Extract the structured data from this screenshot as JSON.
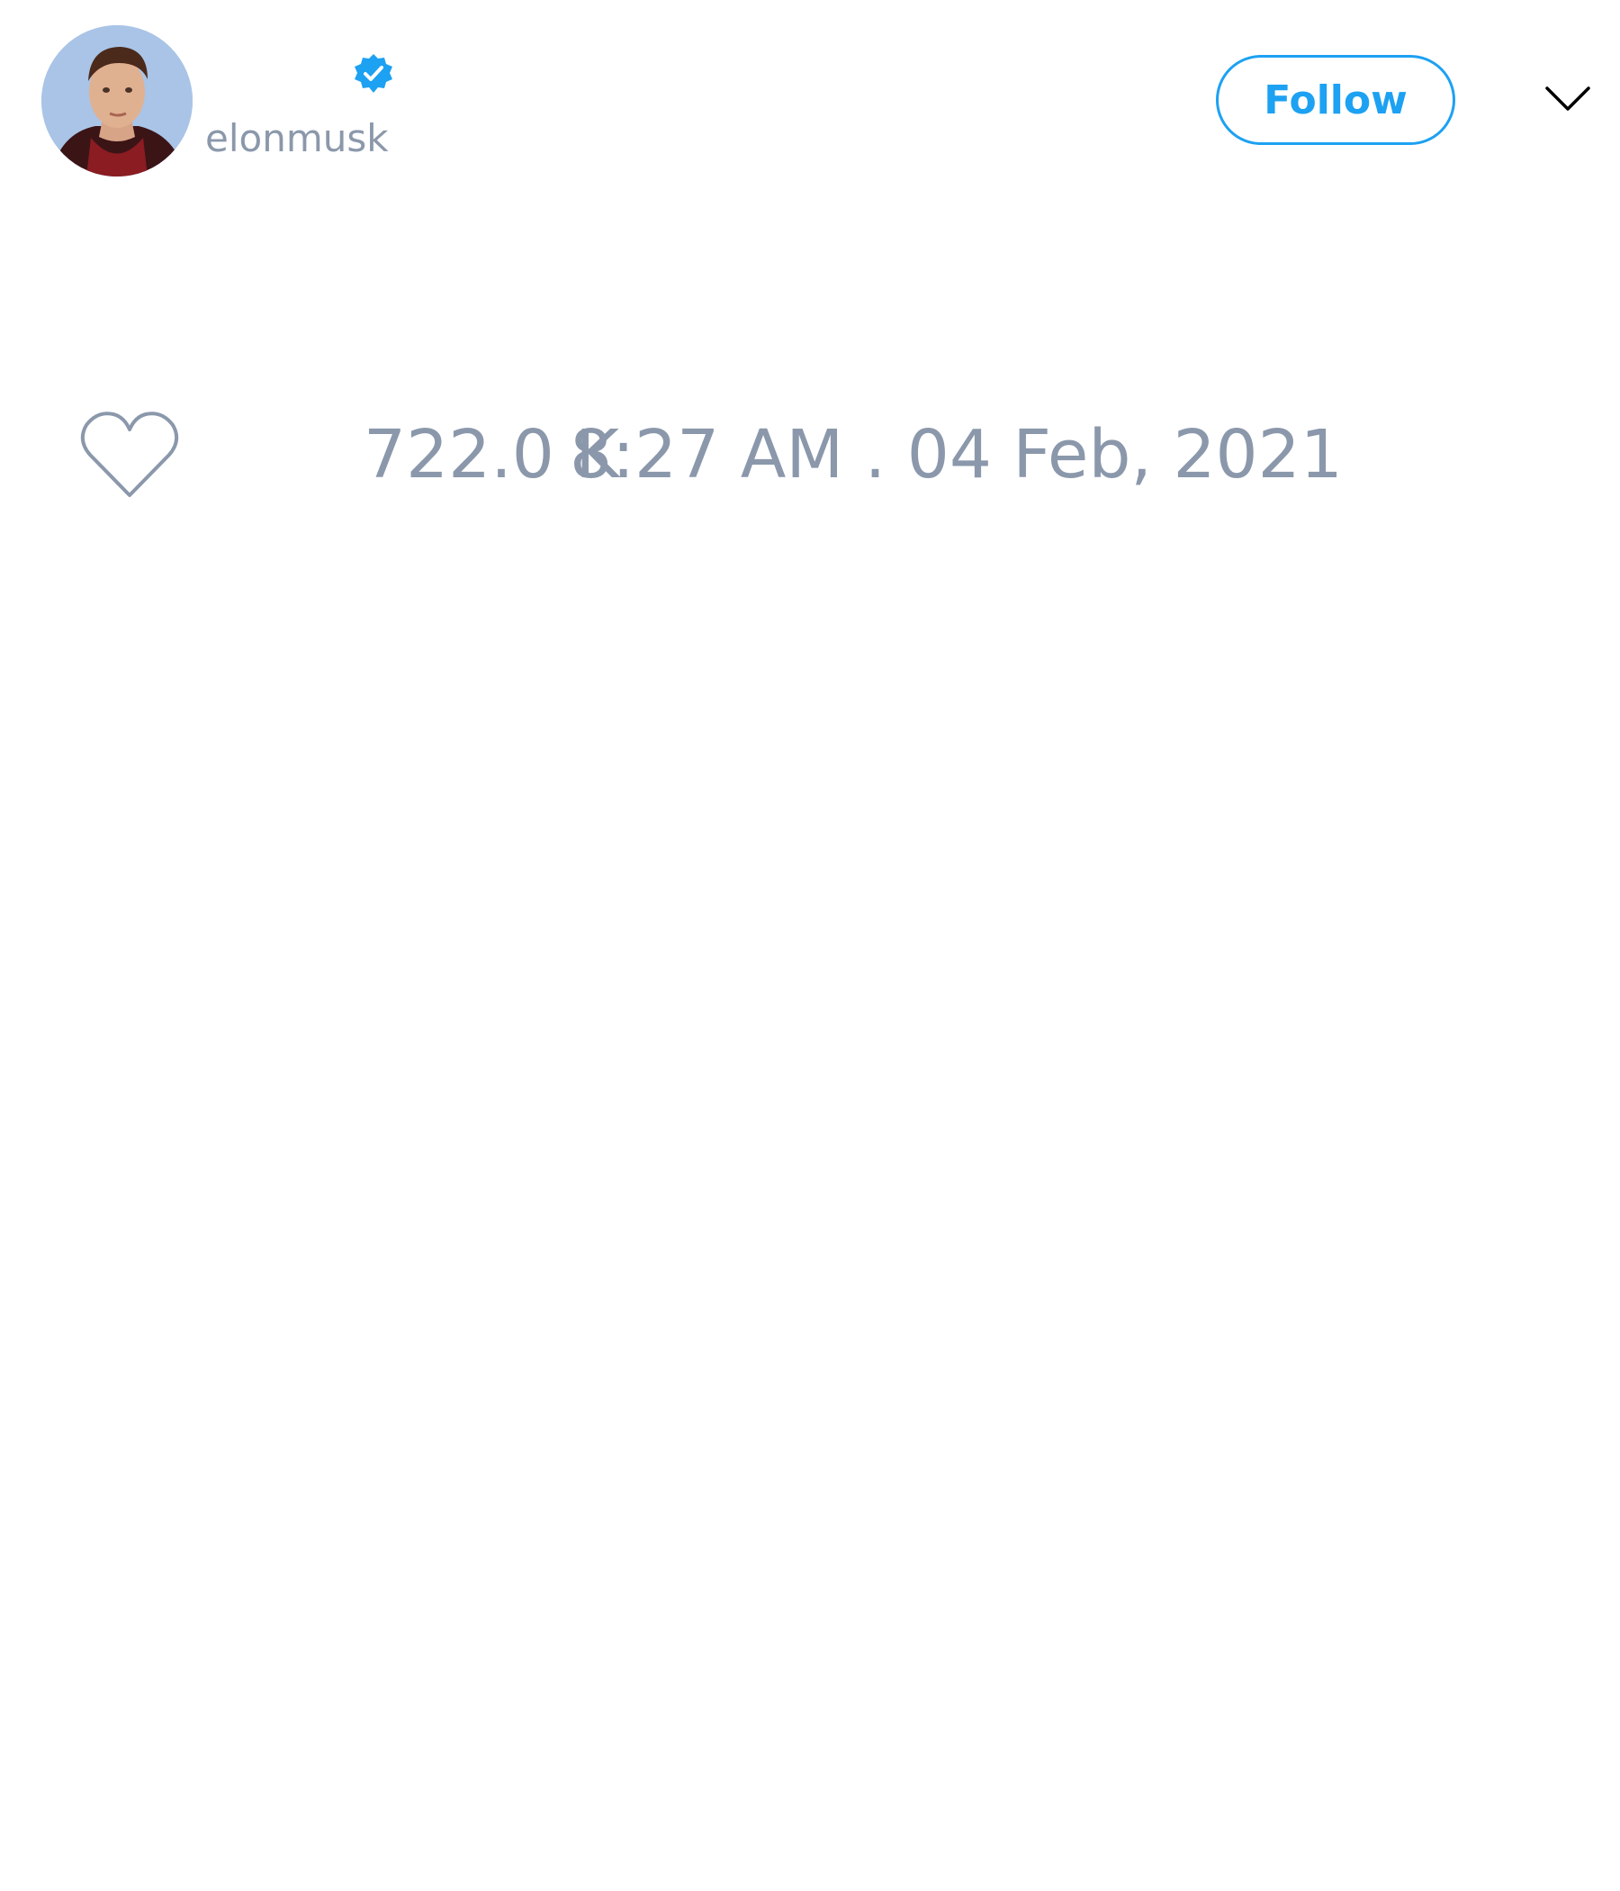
{
  "tweet": {
    "display_name": "",
    "username": "elonmusk",
    "verified_icon": "verified-badge-icon",
    "follow_label": "Follow",
    "menu_icon": "chevron-down-icon",
    "like_icon": "heart-icon",
    "like_count": "722.0 K",
    "timestamp": "8:27 AM . 04 Feb, 2021"
  },
  "colors": {
    "accent": "#1da1f2",
    "muted_text": "#8b98ab"
  }
}
